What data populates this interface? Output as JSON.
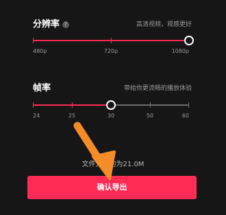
{
  "resolution": {
    "title": "分辨率",
    "help_icon": "?",
    "hint": "高清视频，观感更好",
    "options": [
      "480p",
      "720p",
      "1080p"
    ],
    "selected": "1080p"
  },
  "frame_rate": {
    "title": "帧率",
    "hint": "带给你更流畅的播放体验",
    "options": [
      "24",
      "25",
      "30",
      "50",
      "60"
    ],
    "selected": "30"
  },
  "file_size_text": "文件大小约为21.0M",
  "export_button_label": "确认导出",
  "colors": {
    "accent": "#fe2c55",
    "background": "#161616",
    "annotation_arrow": "#f58c27"
  }
}
